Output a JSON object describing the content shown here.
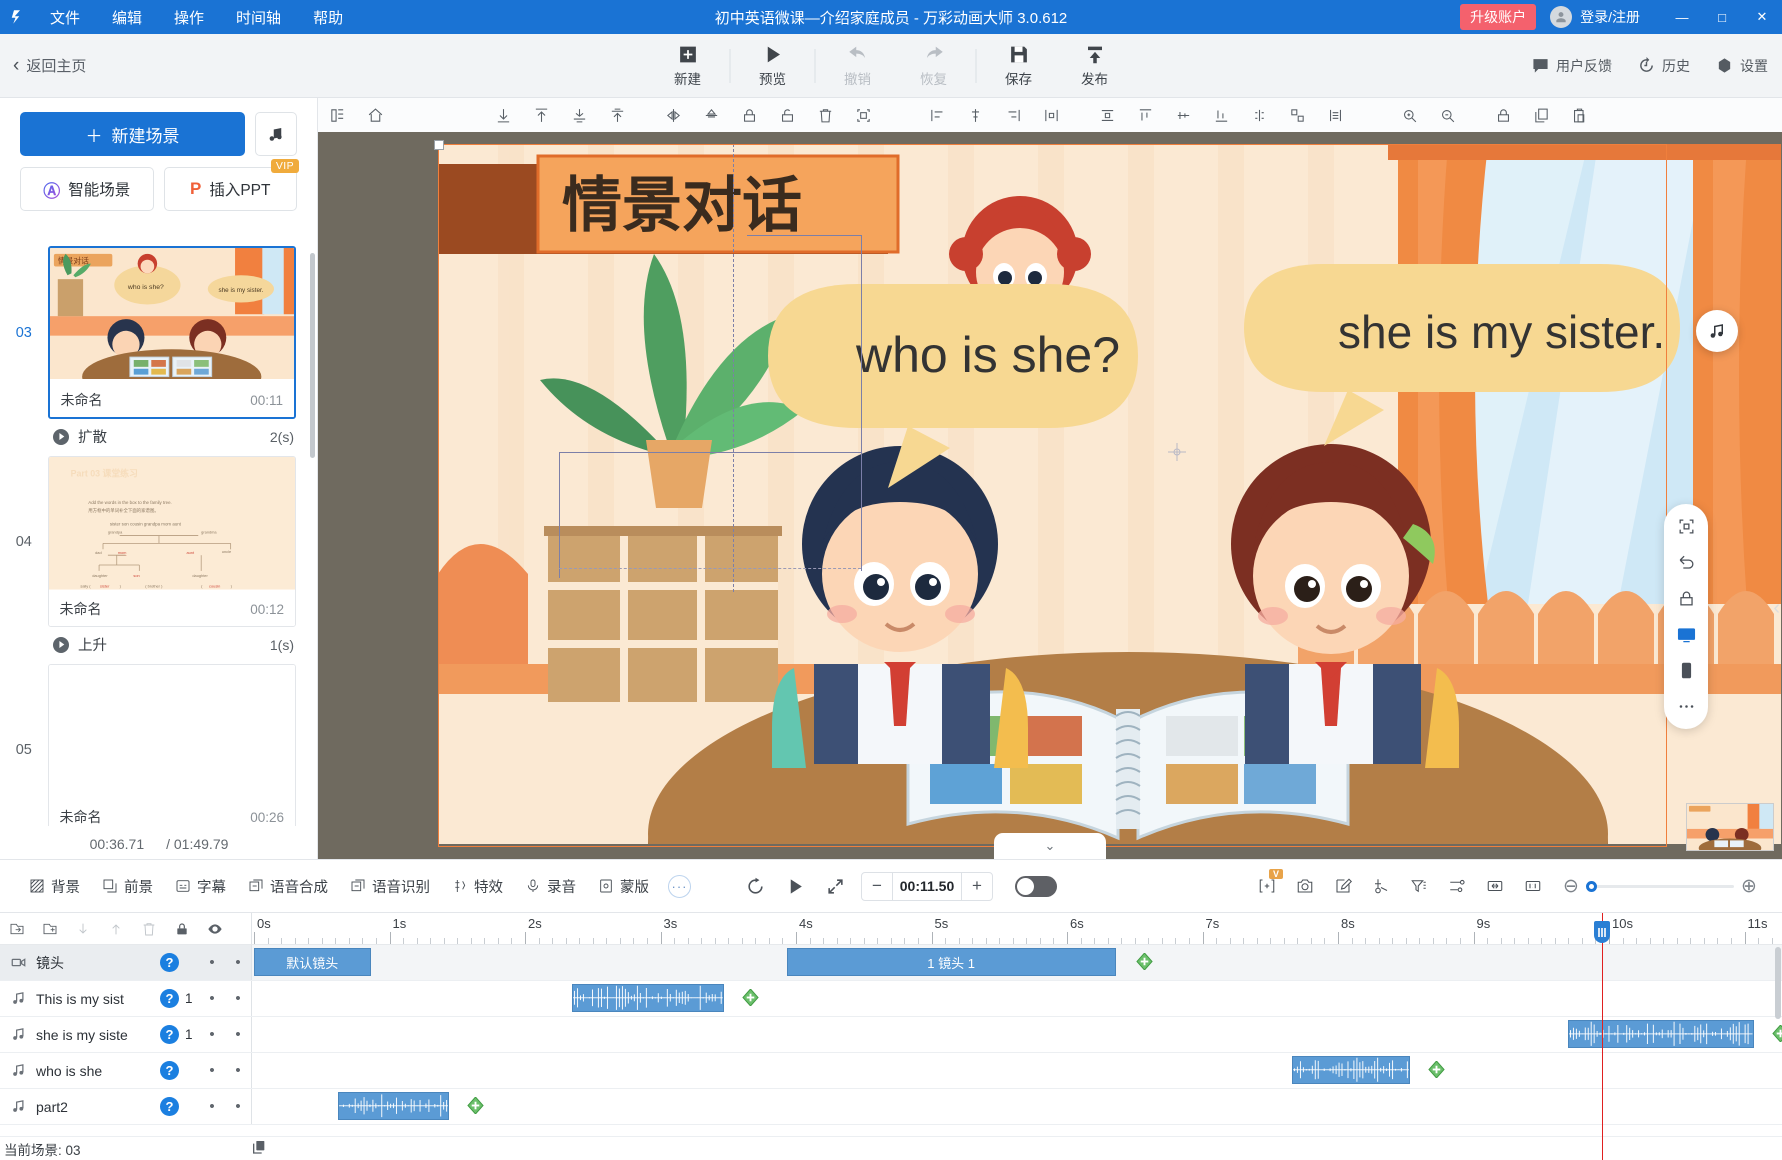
{
  "titlebar": {
    "logo": "logo-icon",
    "menus": [
      "文件",
      "编辑",
      "操作",
      "时间轴",
      "帮助"
    ],
    "window_title": "初中英语微课—介绍家庭成员 - 万彩动画大师 3.0.612",
    "upgrade_label": "升级账户",
    "account_label": "登录/注册",
    "minimize": "—",
    "maximize": "□",
    "close": "✕",
    "accent_blue": "#1a73d4",
    "upgrade_red": "#f4616d"
  },
  "topbar": {
    "back_label": "返回主页",
    "tools": [
      {
        "label": "新建",
        "icon": "plus-square-icon",
        "disabled": false
      },
      {
        "label": "预览",
        "icon": "play-icon",
        "disabled": false
      },
      {
        "label": "撤销",
        "icon": "undo-icon",
        "disabled": true
      },
      {
        "label": "恢复",
        "icon": "redo-icon",
        "disabled": true
      },
      {
        "label": "保存",
        "icon": "save-icon",
        "disabled": false
      },
      {
        "label": "发布",
        "icon": "publish-icon",
        "disabled": false
      }
    ],
    "right_items": [
      {
        "label": "用户反馈",
        "icon": "feedback-icon"
      },
      {
        "label": "历史",
        "icon": "history-icon"
      },
      {
        "label": "设置",
        "icon": "gear-icon"
      }
    ]
  },
  "scene_panel": {
    "new_scene_label": "新建场景",
    "music_icon": "music-note-icon",
    "ai_scene_label": "智能场景",
    "insert_ppt_label": "插入PPT",
    "vip_tag": "VIP",
    "scenes": [
      {
        "number": "03",
        "name": "未命名",
        "duration": "00:11",
        "selected": true,
        "thumb": "classroom-dialogue"
      },
      {
        "number": "04",
        "name": "未命名",
        "duration": "00:12",
        "selected": false,
        "thumb": "family-tree-worksheet"
      },
      {
        "number": "05",
        "name": "未命名",
        "duration": "00:26",
        "selected": false,
        "thumb": "blank"
      }
    ],
    "transitions": [
      {
        "name": "扩散",
        "duration": "2(s)"
      },
      {
        "name": "上升",
        "duration": "1(s)"
      }
    ],
    "current_time": "00:36.71",
    "total_time": "/ 01:49.79"
  },
  "canvas_toolbar": {
    "left_icons": [
      "layers-icon",
      "home-icon"
    ],
    "align_icons": [
      "align-bottom-icon",
      "align-top-icon",
      "align-middle-icon",
      "align-stretch-icon",
      "flip-horizontal-icon",
      "flip-vertical-icon",
      "lock-icon",
      "unlock-icon",
      "delete-icon",
      "select-all-icon",
      "align-left-icon",
      "align-center-h-icon",
      "align-right-icon",
      "distribute-h-icon",
      "distribute-v-icon",
      "align-top2-icon",
      "align-middle2-icon",
      "align-bottom2-icon",
      "group-icon",
      "ungroup-icon",
      "spacing-icon",
      "zoom-in-icon",
      "zoom-out-icon",
      "lock2-icon",
      "copy-icon",
      "paste-icon"
    ]
  },
  "canvas": {
    "title_banner": "情景对话",
    "speech_bubble_left": "who is she?",
    "speech_bubble_right": "she is my sister.",
    "stage_bottom_tab_icon": "chevron-down-icon",
    "rail_icons": [
      "fit-screen-icon",
      "undo-curve-icon",
      "lock-icon",
      "desktop-icon",
      "mobile-icon",
      "more-icon"
    ],
    "music_bubble_icon": "music-note-icon"
  },
  "playbar": {
    "tools": [
      {
        "label": "背景",
        "icon": "background-icon"
      },
      {
        "label": "前景",
        "icon": "foreground-icon"
      },
      {
        "label": "字幕",
        "icon": "subtitle-icon"
      },
      {
        "label": "语音合成",
        "icon": "tts-icon"
      },
      {
        "label": "语音识别",
        "icon": "asr-icon"
      },
      {
        "label": "特效",
        "icon": "effects-icon"
      },
      {
        "label": "录音",
        "icon": "microphone-icon"
      },
      {
        "label": "蒙版",
        "icon": "mask-icon"
      }
    ],
    "more_label": "···",
    "replay_icon": "replay-icon",
    "play_icon": "play-icon",
    "fullscreen_icon": "expand-icon",
    "time_value": "00:11.50",
    "minus": "−",
    "plus": "+",
    "toggle_on": false,
    "right_icons": [
      {
        "icon": "fit-width-icon",
        "badge": "V"
      },
      {
        "icon": "camera-icon",
        "badge": ""
      },
      {
        "icon": "edit-icon",
        "badge": ""
      },
      {
        "icon": "cut-icon",
        "badge": ""
      },
      {
        "icon": "filter-icon",
        "badge": ""
      },
      {
        "icon": "settings-sliders-icon",
        "badge": ""
      },
      {
        "icon": "fit-timeline-icon",
        "badge": ""
      },
      {
        "icon": "one-to-one-icon",
        "badge": ""
      }
    ],
    "zoom_minus": "⊖",
    "zoom_plus": "⊕",
    "zoom_percent": 0
  },
  "timeline": {
    "header_icons": [
      {
        "icon": "import-track-icon",
        "disabled": false
      },
      {
        "icon": "add-track-icon",
        "disabled": false
      },
      {
        "icon": "move-down-icon",
        "disabled": true
      },
      {
        "icon": "move-up-icon",
        "disabled": true
      },
      {
        "icon": "delete-track-icon",
        "disabled": true
      },
      {
        "icon": "lock-track-icon",
        "disabled": false
      },
      {
        "icon": "eye-visibility-icon",
        "disabled": false
      }
    ],
    "ruler_labels": [
      "0s",
      "1s",
      "2s",
      "3s",
      "4s",
      "5s",
      "6s",
      "7s",
      "8s",
      "9s",
      "10s",
      "11s"
    ],
    "playhead_time_s": 9.95,
    "help_badge": "?",
    "tracks": [
      {
        "name": "镜头",
        "icon": "camera-track-icon",
        "count": "",
        "active": true,
        "clips": [
          {
            "label": "默认镜头",
            "start_s": 0.0,
            "end_s": 0.86,
            "type": "camera"
          },
          {
            "label": "1 镜头 1",
            "start_s": 3.93,
            "end_s": 6.36,
            "type": "camera"
          }
        ],
        "keyframes": [
          6.57
        ]
      },
      {
        "name": "This is my sist",
        "icon": "audio-track-icon",
        "count": "1",
        "active": false,
        "clips": [
          {
            "label": "",
            "start_s": 2.35,
            "end_s": 3.47,
            "type": "audio"
          }
        ],
        "keyframes": [
          3.66
        ]
      },
      {
        "name": "she is my siste",
        "icon": "audio-track-icon",
        "count": "1",
        "active": false,
        "clips": [
          {
            "label": "",
            "start_s": 9.7,
            "end_s": 11.07,
            "type": "audio"
          }
        ],
        "keyframes": [
          11.26
        ]
      },
      {
        "name": "who  is  she",
        "icon": "audio-track-icon",
        "count": "",
        "active": false,
        "clips": [
          {
            "label": "",
            "start_s": 7.66,
            "end_s": 8.53,
            "type": "audio"
          }
        ],
        "keyframes": [
          8.72
        ]
      },
      {
        "name": "part2",
        "icon": "audio-track-icon",
        "count": "",
        "active": false,
        "clips": [
          {
            "label": "",
            "start_s": 0.62,
            "end_s": 1.44,
            "type": "audio"
          }
        ],
        "keyframes": [
          1.63
        ]
      }
    ],
    "footer_label": "当前场景: 03",
    "footer_icon": "duplicate-icon"
  }
}
